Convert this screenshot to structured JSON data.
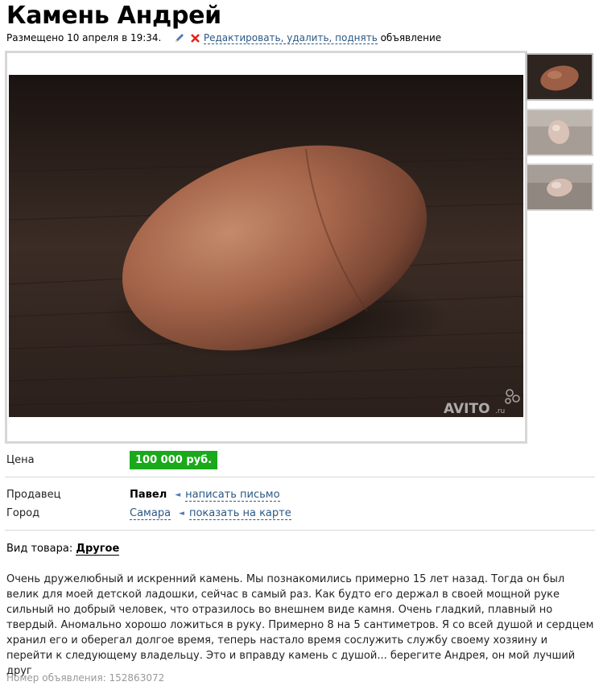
{
  "title": "Камень Андрей",
  "meta": {
    "posted": "Размещено 10 апреля в 19:34.",
    "actions_link": "Редактировать, удалить, поднять",
    "actions_suffix": "объявление"
  },
  "gallery": {
    "watermark": "AVITO",
    "watermark_suffix": ".ru",
    "thumb_count": 3
  },
  "price": {
    "label": "Цена",
    "value": "100 000 руб."
  },
  "seller": {
    "label": "Продавец",
    "name": "Павел",
    "contact_link": "написать письмо"
  },
  "city": {
    "label": "Город",
    "name": "Самара",
    "map_link": "показать на карте"
  },
  "category": {
    "label": "Вид товара:",
    "value": "Другое"
  },
  "description": "Очень дружелюбный и искренний камень. Мы познакомились примерно 15 лет назад. Тогда он был велик для моей детской ладошки, сейчас в самый раз. Как будто его держал в своей мощной руке сильный но добрый человек, что отразилось во внешнем виде камня. Очень гладкий, плавный но твердый. Аномально хорошо ложиться в руку. Примерно 8 на 5 сантиметров. Я со всей душой и сердцем хранил его и оберегал долгое время, теперь настало время сослужить службу своему хозяину и перейти к следующему владельцу. Это и вправду камень с душой... берегите Андрея, он мой лучший друг",
  "ad_number": "Номер объявления: 152863072",
  "colors": {
    "price_badge": "#1aa91a",
    "link": "#2a5885",
    "delete": "#e0261d"
  }
}
